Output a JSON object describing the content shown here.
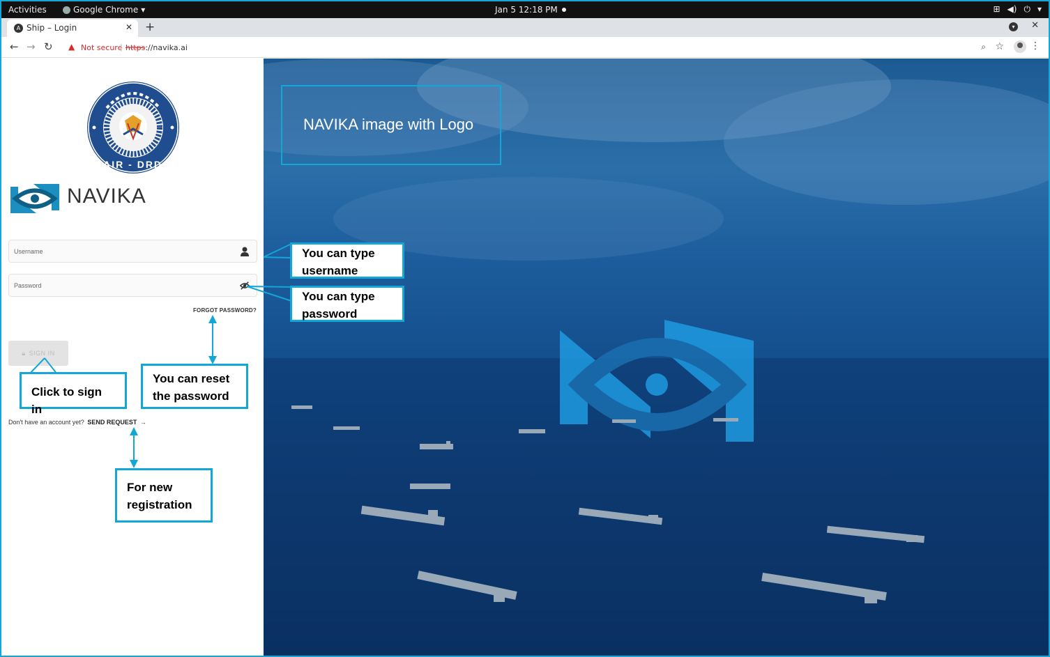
{
  "system_bar": {
    "activities": "Activities",
    "app_name": "Google Chrome",
    "datetime": "Jan 5  12:18 PM"
  },
  "browser": {
    "tab_title": "Ship – Login",
    "security_label": "Not secure",
    "url_scheme": "https",
    "url_rest": "://navika.ai",
    "icons": {
      "back": "arrow-left-icon",
      "forward": "arrow-right-icon",
      "reload": "reload-icon",
      "zoom": "zoom-icon",
      "bookmark": "star-icon",
      "profile": "profile-icon",
      "menu": "kebab-menu-icon"
    }
  },
  "login": {
    "emblem_text": "CAIR - DRDO",
    "brand": "NAVIKA",
    "username_placeholder": "Username",
    "password_placeholder": "Password",
    "forgot_label": "FORGOT PASSWORD?",
    "signin_label": "SIGN IN",
    "no_account_text": "Don't have an account yet?",
    "send_request_label": "SEND REQUEST",
    "arrow": "→"
  },
  "hero": {
    "caption": "NAVIKA image with Logo",
    "accent_color": "#12a7d6"
  },
  "annotations": {
    "username": "You can type username",
    "password": "You can type password",
    "reset": "You can reset the password",
    "signin": "Click to sign in",
    "register": "For new registration"
  }
}
